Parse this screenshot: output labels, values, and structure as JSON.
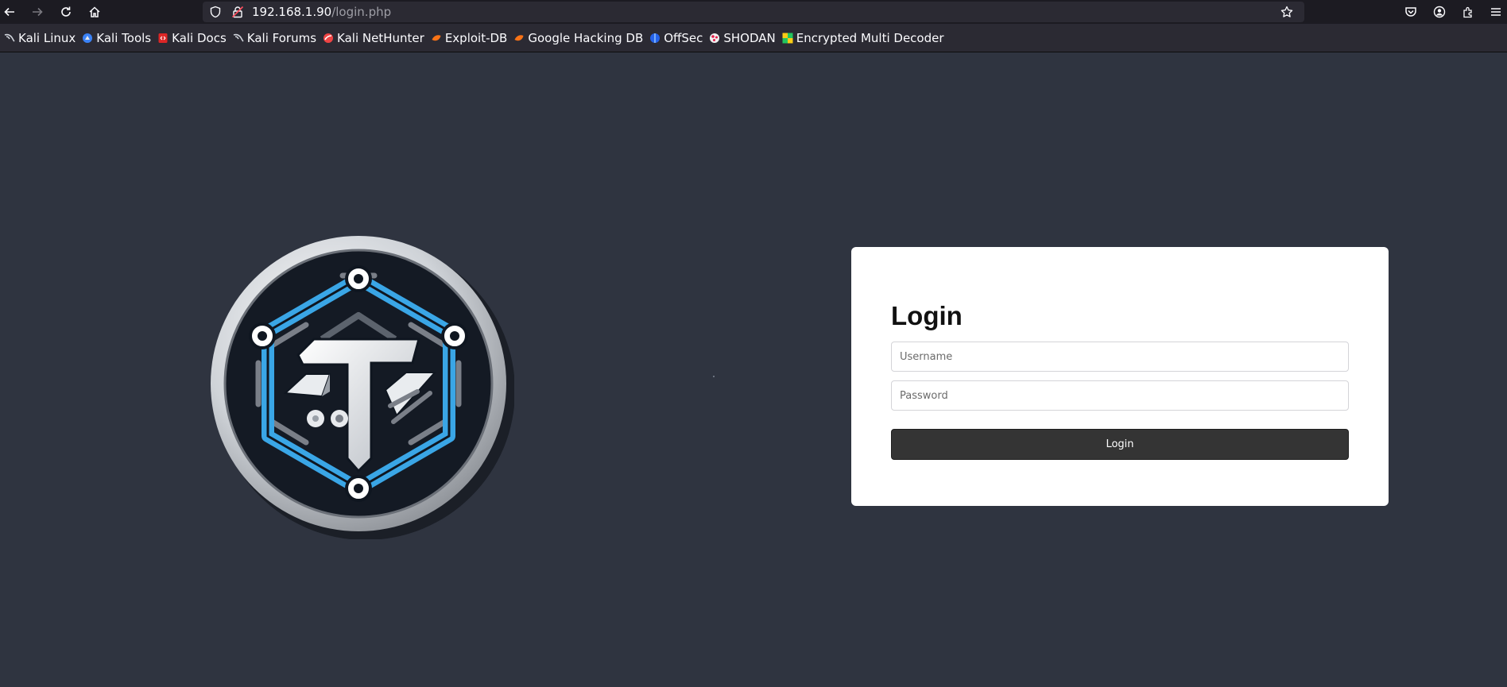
{
  "browser": {
    "url_host": "192.168.1.90",
    "url_path": "/login.php",
    "nav_icons": [
      "back-icon",
      "forward-icon",
      "reload-icon",
      "home-icon"
    ],
    "toolbar_icons": [
      "pocket-icon",
      "account-icon",
      "extensions-icon",
      "menu-icon"
    ]
  },
  "bookmarks": [
    {
      "label": "Kali Linux",
      "icon": "kali-dragon-icon"
    },
    {
      "label": "Kali Tools",
      "icon": "kali-tools-icon"
    },
    {
      "label": "Kali Docs",
      "icon": "kali-docs-icon"
    },
    {
      "label": "Kali Forums",
      "icon": "kali-dragon-icon"
    },
    {
      "label": "Kali NetHunter",
      "icon": "nethunter-icon"
    },
    {
      "label": "Exploit-DB",
      "icon": "exploit-db-icon"
    },
    {
      "label": "Google Hacking DB",
      "icon": "exploit-db-icon"
    },
    {
      "label": "OffSec",
      "icon": "offsec-icon"
    },
    {
      "label": "SHODAN",
      "icon": "shodan-icon"
    },
    {
      "label": "Encrypted Multi Decoder",
      "icon": "decoder-icon"
    }
  ],
  "login": {
    "title": "Login",
    "username_placeholder": "Username",
    "password_placeholder": "Password",
    "button_label": "Login"
  },
  "colors": {
    "page_background": "#2f3440",
    "card_background": "#ffffff",
    "button_background": "#343434",
    "logo_accent": "#3aa6e6"
  }
}
